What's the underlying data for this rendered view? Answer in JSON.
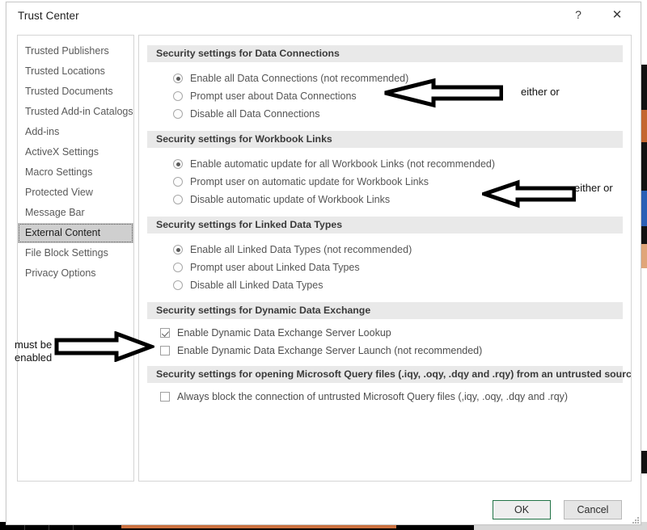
{
  "window": {
    "title": "Trust Center",
    "help_label": "?",
    "close_label": "✕"
  },
  "sidebar": {
    "items": [
      {
        "label": "Trusted Publishers",
        "selected": false
      },
      {
        "label": "Trusted Locations",
        "selected": false
      },
      {
        "label": "Trusted Documents",
        "selected": false
      },
      {
        "label": "Trusted Add-in Catalogs",
        "selected": false
      },
      {
        "label": "Add-ins",
        "selected": false
      },
      {
        "label": "ActiveX Settings",
        "selected": false
      },
      {
        "label": "Macro Settings",
        "selected": false
      },
      {
        "label": "Protected View",
        "selected": false
      },
      {
        "label": "Message Bar",
        "selected": false
      },
      {
        "label": "External Content",
        "selected": true
      },
      {
        "label": "File Block Settings",
        "selected": false
      },
      {
        "label": "Privacy Options",
        "selected": false
      }
    ]
  },
  "sections": [
    {
      "id": "data-connections",
      "header": "Security settings for Data Connections",
      "control_type": "radio",
      "options": [
        {
          "label": "Enable all Data Connections (not recommended)",
          "checked": true,
          "accel": "E"
        },
        {
          "label": "Prompt user about Data Connections",
          "checked": false,
          "accel": "P"
        },
        {
          "label": "Disable all Data Connections",
          "checked": false,
          "accel": "D"
        }
      ]
    },
    {
      "id": "workbook-links",
      "header": "Security settings for Workbook Links",
      "control_type": "radio",
      "options": [
        {
          "label": "Enable automatic update for all Workbook Links (not recommended)",
          "checked": true,
          "accel": "a"
        },
        {
          "label": "Prompt user on automatic update for Workbook Links",
          "checked": false,
          "accel": "r"
        },
        {
          "label": "Disable automatic update of Workbook Links",
          "checked": false,
          "accel": "i"
        }
      ]
    },
    {
      "id": "linked-data-types",
      "header": "Security settings for Linked Data Types",
      "control_type": "radio",
      "options": [
        {
          "label": "Enable all Linked Data Types (not recommended)",
          "checked": true,
          "accel": "n"
        },
        {
          "label": "Prompt user about Linked Data Types",
          "checked": false,
          "accel": "o"
        },
        {
          "label": "Disable all Linked Data Types",
          "checked": false,
          "accel": "s"
        }
      ]
    },
    {
      "id": "dynamic-data-exchange",
      "header": "Security settings for Dynamic Data Exchange",
      "control_type": "checkbox",
      "options": [
        {
          "label": "Enable Dynamic Data Exchange Server Lookup",
          "checked": true,
          "accel": "y"
        },
        {
          "label": "Enable Dynamic Data Exchange Server Launch (not recommended)",
          "checked": false,
          "accel": "m"
        }
      ]
    },
    {
      "id": "microsoft-query-files",
      "header": "Security settings for opening  Microsoft Query files (.iqy, .oqy, .dqy and .rqy) from an untrusted source",
      "control_type": "checkbox",
      "options": [
        {
          "label": "Always block the connection of untrusted Microsoft Query files (,iqy, .oqy, .dqy and .rqy)",
          "checked": false,
          "accel": "Q"
        }
      ]
    }
  ],
  "footer": {
    "ok_label": "OK",
    "cancel_label": "Cancel"
  },
  "annotations": [
    {
      "id": "either-or-data-connections",
      "text": "either or"
    },
    {
      "id": "either-or-workbook-links",
      "text": "either or"
    },
    {
      "id": "must-be-enabled",
      "text": "must be\nenabled"
    }
  ],
  "colors": {
    "accent_ok_border": "#217346",
    "section_header_bg": "#e9e9e9",
    "sidebar_selected_bg": "#cfcfcf",
    "dialog_bg": "#ffffff",
    "annotation_ink": "#000000"
  }
}
